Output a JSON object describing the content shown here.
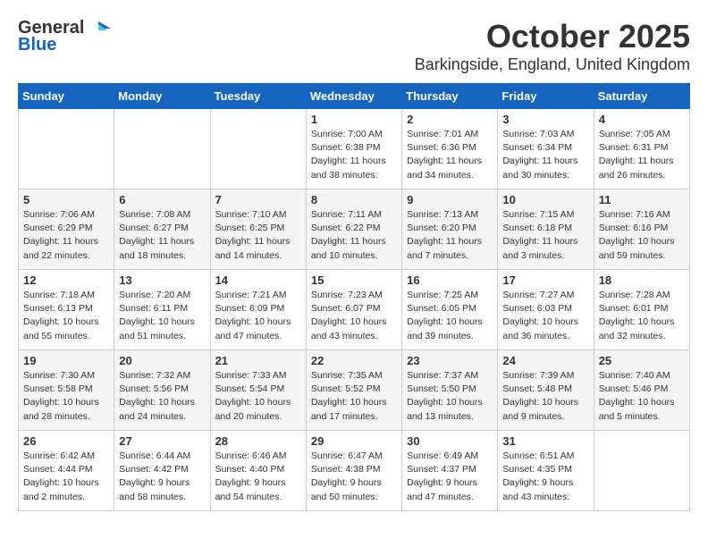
{
  "header": {
    "logo_general": "General",
    "logo_blue": "Blue",
    "month": "October 2025",
    "location": "Barkingside, England, United Kingdom"
  },
  "weekdays": [
    "Sunday",
    "Monday",
    "Tuesday",
    "Wednesday",
    "Thursday",
    "Friday",
    "Saturday"
  ],
  "weeks": [
    [
      {
        "day": "",
        "info": ""
      },
      {
        "day": "",
        "info": ""
      },
      {
        "day": "",
        "info": ""
      },
      {
        "day": "1",
        "info": "Sunrise: 7:00 AM\nSunset: 6:38 PM\nDaylight: 11 hours\nand 38 minutes."
      },
      {
        "day": "2",
        "info": "Sunrise: 7:01 AM\nSunset: 6:36 PM\nDaylight: 11 hours\nand 34 minutes."
      },
      {
        "day": "3",
        "info": "Sunrise: 7:03 AM\nSunset: 6:34 PM\nDaylight: 11 hours\nand 30 minutes."
      },
      {
        "day": "4",
        "info": "Sunrise: 7:05 AM\nSunset: 6:31 PM\nDaylight: 11 hours\nand 26 minutes."
      }
    ],
    [
      {
        "day": "5",
        "info": "Sunrise: 7:06 AM\nSunset: 6:29 PM\nDaylight: 11 hours\nand 22 minutes."
      },
      {
        "day": "6",
        "info": "Sunrise: 7:08 AM\nSunset: 6:27 PM\nDaylight: 11 hours\nand 18 minutes."
      },
      {
        "day": "7",
        "info": "Sunrise: 7:10 AM\nSunset: 6:25 PM\nDaylight: 11 hours\nand 14 minutes."
      },
      {
        "day": "8",
        "info": "Sunrise: 7:11 AM\nSunset: 6:22 PM\nDaylight: 11 hours\nand 10 minutes."
      },
      {
        "day": "9",
        "info": "Sunrise: 7:13 AM\nSunset: 6:20 PM\nDaylight: 11 hours\nand 7 minutes."
      },
      {
        "day": "10",
        "info": "Sunrise: 7:15 AM\nSunset: 6:18 PM\nDaylight: 11 hours\nand 3 minutes."
      },
      {
        "day": "11",
        "info": "Sunrise: 7:16 AM\nSunset: 6:16 PM\nDaylight: 10 hours\nand 59 minutes."
      }
    ],
    [
      {
        "day": "12",
        "info": "Sunrise: 7:18 AM\nSunset: 6:13 PM\nDaylight: 10 hours\nand 55 minutes."
      },
      {
        "day": "13",
        "info": "Sunrise: 7:20 AM\nSunset: 6:11 PM\nDaylight: 10 hours\nand 51 minutes."
      },
      {
        "day": "14",
        "info": "Sunrise: 7:21 AM\nSunset: 6:09 PM\nDaylight: 10 hours\nand 47 minutes."
      },
      {
        "day": "15",
        "info": "Sunrise: 7:23 AM\nSunset: 6:07 PM\nDaylight: 10 hours\nand 43 minutes."
      },
      {
        "day": "16",
        "info": "Sunrise: 7:25 AM\nSunset: 6:05 PM\nDaylight: 10 hours\nand 39 minutes."
      },
      {
        "day": "17",
        "info": "Sunrise: 7:27 AM\nSunset: 6:03 PM\nDaylight: 10 hours\nand 36 minutes."
      },
      {
        "day": "18",
        "info": "Sunrise: 7:28 AM\nSunset: 6:01 PM\nDaylight: 10 hours\nand 32 minutes."
      }
    ],
    [
      {
        "day": "19",
        "info": "Sunrise: 7:30 AM\nSunset: 5:58 PM\nDaylight: 10 hours\nand 28 minutes."
      },
      {
        "day": "20",
        "info": "Sunrise: 7:32 AM\nSunset: 5:56 PM\nDaylight: 10 hours\nand 24 minutes."
      },
      {
        "day": "21",
        "info": "Sunrise: 7:33 AM\nSunset: 5:54 PM\nDaylight: 10 hours\nand 20 minutes."
      },
      {
        "day": "22",
        "info": "Sunrise: 7:35 AM\nSunset: 5:52 PM\nDaylight: 10 hours\nand 17 minutes."
      },
      {
        "day": "23",
        "info": "Sunrise: 7:37 AM\nSunset: 5:50 PM\nDaylight: 10 hours\nand 13 minutes."
      },
      {
        "day": "24",
        "info": "Sunrise: 7:39 AM\nSunset: 5:48 PM\nDaylight: 10 hours\nand 9 minutes."
      },
      {
        "day": "25",
        "info": "Sunrise: 7:40 AM\nSunset: 5:46 PM\nDaylight: 10 hours\nand 5 minutes."
      }
    ],
    [
      {
        "day": "26",
        "info": "Sunrise: 6:42 AM\nSunset: 4:44 PM\nDaylight: 10 hours\nand 2 minutes."
      },
      {
        "day": "27",
        "info": "Sunrise: 6:44 AM\nSunset: 4:42 PM\nDaylight: 9 hours\nand 58 minutes."
      },
      {
        "day": "28",
        "info": "Sunrise: 6:46 AM\nSunset: 4:40 PM\nDaylight: 9 hours\nand 54 minutes."
      },
      {
        "day": "29",
        "info": "Sunrise: 6:47 AM\nSunset: 4:38 PM\nDaylight: 9 hours\nand 50 minutes."
      },
      {
        "day": "30",
        "info": "Sunrise: 6:49 AM\nSunset: 4:37 PM\nDaylight: 9 hours\nand 47 minutes."
      },
      {
        "day": "31",
        "info": "Sunrise: 6:51 AM\nSunset: 4:35 PM\nDaylight: 9 hours\nand 43 minutes."
      },
      {
        "day": "",
        "info": ""
      }
    ]
  ]
}
